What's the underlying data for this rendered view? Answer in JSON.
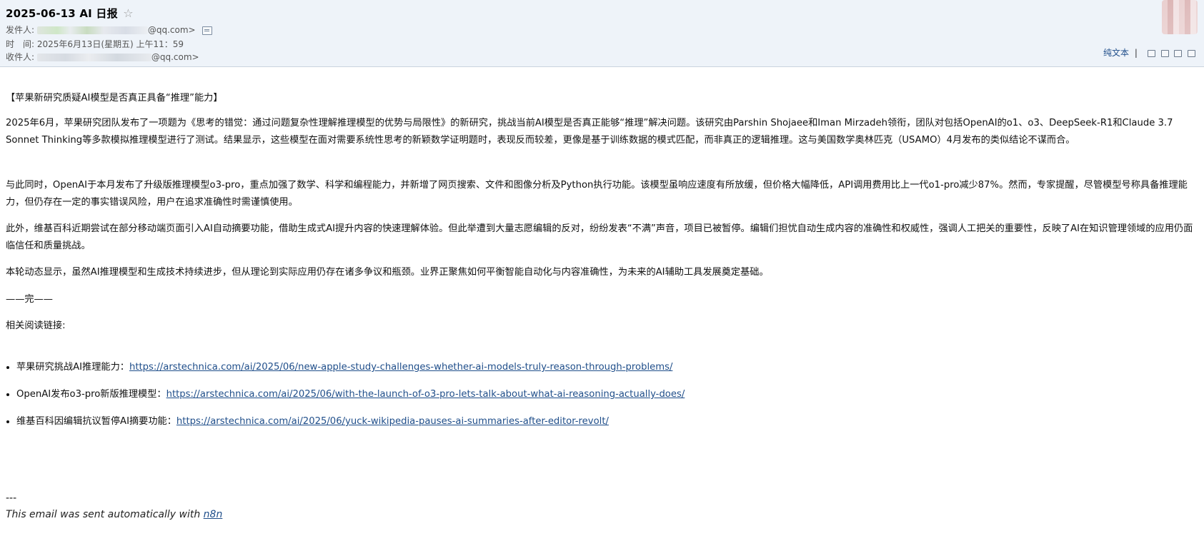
{
  "email": {
    "subject": "2025-06-13 AI 日报",
    "star_icon": "☆",
    "sender_label": "发件人:",
    "sender_suffix": "@qq.com>",
    "time_label": "时　间:",
    "time_value": "2025年6月13日(星期五) 上午11：59",
    "recipient_label": "收件人:",
    "recipient_suffix": "@qq.com>"
  },
  "toolbar": {
    "plain_text": "纯文本",
    "separator": "|",
    "icons": [
      "window-icon",
      "copy-icon",
      "new-window-icon",
      "print-icon",
      "chevron-down-icon"
    ]
  },
  "body": {
    "headline": "【苹果新研究质疑AI模型是否真正具备“推理”能力】",
    "paragraphs": [
      "2025年6月，苹果研究团队发布了一项题为《思考的错觉：通过问题复杂性理解推理模型的优势与局限性》的新研究，挑战当前AI模型是否真正能够“推理”解决问题。该研究由Parshin Shojaee和Iman Mirzadeh领衔，团队对包括OpenAI的o1、o3、DeepSeek-R1和Claude 3.7 Sonnet Thinking等多款模拟推理模型进行了测试。结果显示，这些模型在面对需要系统性思考的新颖数学证明题时，表现反而较差，更像是基于训练数据的模式匹配，而非真正的逻辑推理。这与美国数学奥林匹克（USAMO）4月发布的类似结论不谋而合。",
      "与此同时，OpenAI于本月发布了升级版推理模型o3-pro，重点加强了数学、科学和编程能力，并新增了网页搜索、文件和图像分析及Python执行功能。该模型虽响应速度有所放缓，但价格大幅降低，API调用费用比上一代o1-pro减少87%。然而，专家提醒，尽管模型号称具备推理能力，但仍存在一定的事实错误风险，用户在追求准确性时需谨慎使用。",
      "此外，维基百科近期尝试在部分移动端页面引入AI自动摘要功能，借助生成式AI提升内容的快速理解体验。但此举遭到大量志愿编辑的反对，纷纷发表“不满”声音，项目已被暂停。编辑们担忧自动生成内容的准确性和权威性，强调人工把关的重要性，反映了AI在知识管理领域的应用仍面临信任和质量挑战。",
      "本轮动态显示，虽然AI推理模型和生成技术持续进步，但从理论到实际应用仍存在诸多争议和瓶颈。业界正聚焦如何平衡智能自动化与内容准确性，为未来的AI辅助工具发展奠定基础。"
    ],
    "end_mark": "——完——",
    "related_label": "相关阅读链接:",
    "links": [
      {
        "label": "苹果研究挑战AI推理能力：",
        "url": "https://arstechnica.com/ai/2025/06/new-apple-study-challenges-whether-ai-models-truly-reason-through-problems/"
      },
      {
        "label": "OpenAI发布o3-pro新版推理模型：",
        "url": "https://arstechnica.com/ai/2025/06/with-the-launch-of-o3-pro-lets-talk-about-what-ai-reasoning-actually-does/"
      },
      {
        "label": "维基百科因编辑抗议暂停AI摘要功能：",
        "url": "https://arstechnica.com/ai/2025/06/yuck-wikipedia-pauses-ai-summaries-after-editor-revolt/"
      }
    ],
    "signature_separator": "---",
    "signature_text": "This email was sent automatically with ",
    "signature_link": "n8n"
  },
  "colors": {
    "header_bg": "#eef3f9",
    "link": "#1f4e8a"
  }
}
